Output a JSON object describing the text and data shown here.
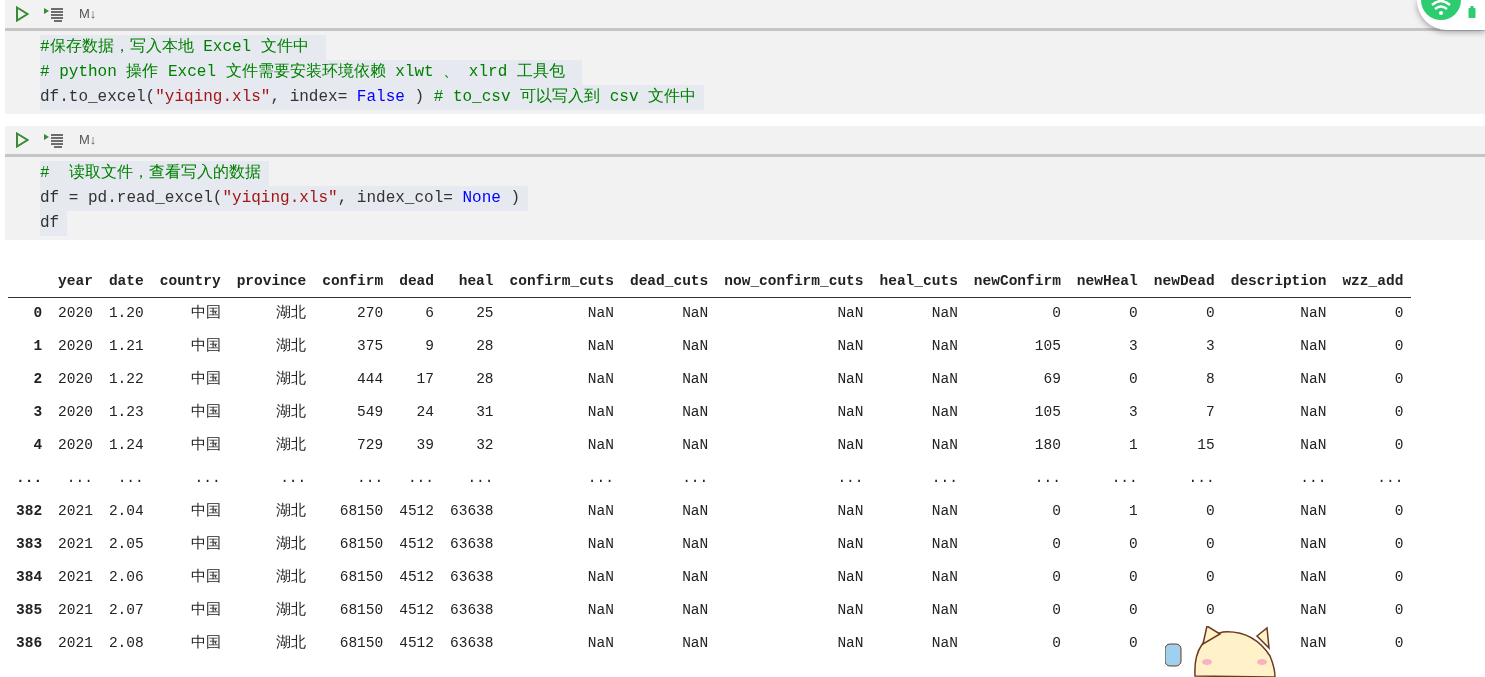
{
  "cells": [
    {
      "toolbar": {
        "markdown_label": "M↓"
      },
      "lines": [
        [
          {
            "kind": "comment",
            "text": "#保存数据，写入本地 Excel 文件中 "
          }
        ],
        [
          {
            "kind": "comment",
            "text": "# python 操作 Excel 文件需要安装环境依赖 xlwt 、 xlrd 工具包 "
          }
        ],
        [
          {
            "kind": "plain",
            "text": "df.to_excel("
          },
          {
            "kind": "string",
            "text": "\"yiqing.xls\""
          },
          {
            "kind": "plain",
            "text": ", index= "
          },
          {
            "kind": "keyword",
            "text": "False"
          },
          {
            "kind": "plain",
            "text": " ) "
          },
          {
            "kind": "comment",
            "text": "# to_csv 可以写入到 csv 文件中"
          }
        ]
      ]
    },
    {
      "toolbar": {
        "markdown_label": "M↓"
      },
      "lines": [
        [
          {
            "kind": "comment",
            "text": "#  读取文件，查看写入的数据"
          }
        ],
        [
          {
            "kind": "plain",
            "text": "df = pd.read_excel("
          },
          {
            "kind": "string",
            "text": "\"yiqing.xls\""
          },
          {
            "kind": "plain",
            "text": ", index_col= "
          },
          {
            "kind": "keyword",
            "text": "None"
          },
          {
            "kind": "plain",
            "text": " )"
          }
        ],
        [
          {
            "kind": "plain",
            "text": "df"
          }
        ]
      ],
      "output": {
        "table": {
          "columns": [
            "year",
            "date",
            "country",
            "province",
            "confirm",
            "dead",
            "heal",
            "confirm_cuts",
            "dead_cuts",
            "now_confirm_cuts",
            "heal_cuts",
            "newConfirm",
            "newHeal",
            "newDead",
            "description",
            "wzz_add"
          ],
          "rows": [
            {
              "index": "0",
              "cells": [
                "2020",
                "1.20",
                "中国",
                "湖北",
                "270",
                "6",
                "25",
                "NaN",
                "NaN",
                "NaN",
                "NaN",
                "0",
                "0",
                "0",
                "NaN",
                "0"
              ]
            },
            {
              "index": "1",
              "cells": [
                "2020",
                "1.21",
                "中国",
                "湖北",
                "375",
                "9",
                "28",
                "NaN",
                "NaN",
                "NaN",
                "NaN",
                "105",
                "3",
                "3",
                "NaN",
                "0"
              ]
            },
            {
              "index": "2",
              "cells": [
                "2020",
                "1.22",
                "中国",
                "湖北",
                "444",
                "17",
                "28",
                "NaN",
                "NaN",
                "NaN",
                "NaN",
                "69",
                "0",
                "8",
                "NaN",
                "0"
              ]
            },
            {
              "index": "3",
              "cells": [
                "2020",
                "1.23",
                "中国",
                "湖北",
                "549",
                "24",
                "31",
                "NaN",
                "NaN",
                "NaN",
                "NaN",
                "105",
                "3",
                "7",
                "NaN",
                "0"
              ]
            },
            {
              "index": "4",
              "cells": [
                "2020",
                "1.24",
                "中国",
                "湖北",
                "729",
                "39",
                "32",
                "NaN",
                "NaN",
                "NaN",
                "NaN",
                "180",
                "1",
                "15",
                "NaN",
                "0"
              ]
            },
            {
              "index": "...",
              "cells": [
                "...",
                "...",
                "...",
                "...",
                "...",
                "...",
                "...",
                "...",
                "...",
                "...",
                "...",
                "...",
                "...",
                "...",
                "...",
                "..."
              ]
            },
            {
              "index": "382",
              "cells": [
                "2021",
                "2.04",
                "中国",
                "湖北",
                "68150",
                "4512",
                "63638",
                "NaN",
                "NaN",
                "NaN",
                "NaN",
                "0",
                "1",
                "0",
                "NaN",
                "0"
              ]
            },
            {
              "index": "383",
              "cells": [
                "2021",
                "2.05",
                "中国",
                "湖北",
                "68150",
                "4512",
                "63638",
                "NaN",
                "NaN",
                "NaN",
                "NaN",
                "0",
                "0",
                "0",
                "NaN",
                "0"
              ]
            },
            {
              "index": "384",
              "cells": [
                "2021",
                "2.06",
                "中国",
                "湖北",
                "68150",
                "4512",
                "63638",
                "NaN",
                "NaN",
                "NaN",
                "NaN",
                "0",
                "0",
                "0",
                "NaN",
                "0"
              ]
            },
            {
              "index": "385",
              "cells": [
                "2021",
                "2.07",
                "中国",
                "湖北",
                "68150",
                "4512",
                "63638",
                "NaN",
                "NaN",
                "NaN",
                "NaN",
                "0",
                "0",
                "0",
                "NaN",
                "0"
              ]
            },
            {
              "index": "386",
              "cells": [
                "2021",
                "2.08",
                "中国",
                "湖北",
                "68150",
                "4512",
                "63638",
                "NaN",
                "NaN",
                "NaN",
                "NaN",
                "0",
                "0",
                null,
                "NaN",
                "0"
              ]
            }
          ]
        }
      }
    }
  ]
}
